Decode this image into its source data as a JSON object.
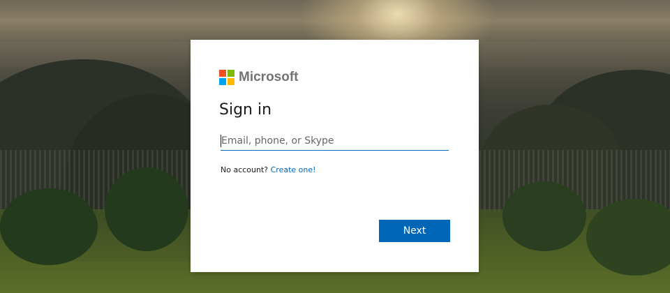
{
  "background": {
    "icon": "mountain-landscape-image"
  },
  "card": {
    "logo": {
      "icon": "microsoft-logo-icon",
      "text": "Microsoft",
      "colors": [
        "#f25022",
        "#7fba00",
        "#00a4ef",
        "#ffb900"
      ]
    },
    "title": "Sign in",
    "email_field": {
      "value": "",
      "placeholder": "Email, phone, or Skype"
    },
    "no_account_text": "No account?",
    "create_link_label": "Create one!",
    "next_button_label": "Next"
  },
  "colors": {
    "accent": "#0067b8",
    "title_text": "#1b1b1b",
    "logo_text": "#737373"
  }
}
